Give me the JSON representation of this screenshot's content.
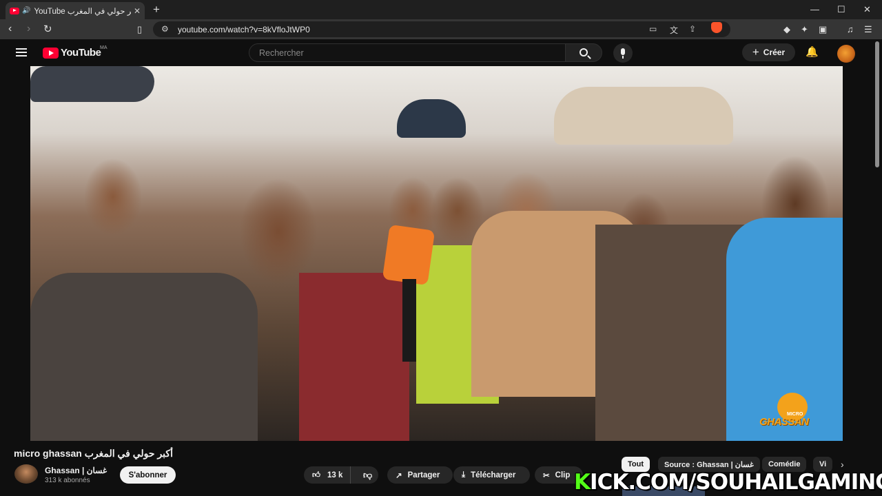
{
  "browser": {
    "tab_title": "أكبر حولي في المغرب - YouTube",
    "tab_title_display": "YouTube أكبر حولي في المغرب",
    "url": "youtube.com/watch?v=8kVfloJtWP0",
    "window_controls": [
      "—",
      "☐",
      "✕"
    ]
  },
  "youtube": {
    "logo_text": "YouTube",
    "country_code": "MA",
    "search_placeholder": "Rechercher",
    "create_label": "Créer"
  },
  "video": {
    "watermark_micro": "MICRO",
    "watermark_brand": "GHASSAN",
    "mic_flag": "Ghassan",
    "overlay_text_prefix": "K",
    "overlay_text_rest": "ICK.COM/SOUHAILGAMING"
  },
  "info": {
    "title": "micro ghassan أكبر حولي في المغرب",
    "channel_name": "Ghassan | غسان",
    "subscribers": "313 k abonnés",
    "subscribe_label": "S'abonner",
    "like_count": "13 k",
    "share_label": "Partager",
    "download_label": "Télécharger",
    "clip_label": "Clip"
  },
  "chips": [
    {
      "label": "Tout",
      "active": true
    },
    {
      "label": "Source : Ghassan | غسان",
      "active": false
    },
    {
      "label": "Comédie",
      "active": false
    },
    {
      "label": "Vi",
      "active": false
    }
  ],
  "icons": {
    "back": "arrow-left-icon",
    "forward": "arrow-right-icon",
    "reload": "reload-icon",
    "bookmark": "bookmark-icon",
    "site_info": "tune-icon",
    "menu": "hamburger-icon",
    "search": "search-icon",
    "voice": "microphone-icon",
    "notifications": "bell-icon",
    "like": "thumbs-up-icon",
    "dislike": "thumbs-down-icon",
    "share": "share-icon",
    "download": "download-icon",
    "clip": "scissors-icon"
  },
  "colors": {
    "youtube_red": "#ff0033",
    "background": "#0f0f0f",
    "pill": "#272727",
    "brave_orange": "#fb542b",
    "kick_green": "#53fc18",
    "watermark_orange": "#f3a21b"
  }
}
